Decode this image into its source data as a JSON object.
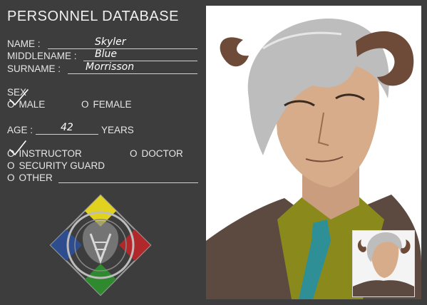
{
  "form": {
    "title": "PERSONNEL DATABASE",
    "name_label": "NAME :",
    "name_value": "Skyler",
    "middlename_label": "MIDDLENAME :",
    "middlename_value": "Blue",
    "surname_label": "SURNAME :",
    "surname_value": "Morrisson",
    "sex_label": "SEX",
    "sex_options": [
      "MALE",
      "FEMALE"
    ],
    "sex_selected": "MALE",
    "age_label": "AGE :",
    "age_value": "42",
    "age_unit": "YEARS",
    "role_options": [
      "INSTRUCTOR",
      "DOCTOR",
      "SECURITY GUARD",
      "OTHER"
    ],
    "role_selected": "INSTRUCTOR",
    "circle_glyph": "O"
  },
  "icons": {
    "checkmark": "checkmark-icon",
    "emblem": "organization-emblem"
  },
  "colors": {
    "background": "#3d3d3d",
    "text": "#e6e6e6",
    "emblem_yellow": "#e0d21f",
    "emblem_blue": "#2d4d8f",
    "emblem_red": "#b1282b",
    "emblem_green": "#2f8a2f",
    "shirt": "#8a8a1c",
    "tie": "#2f8f96"
  }
}
